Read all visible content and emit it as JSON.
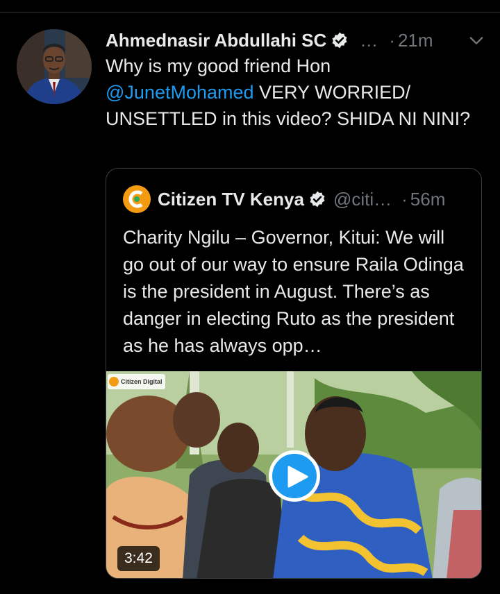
{
  "tweet": {
    "author_name": "Ahmednasir Abdullahi SC",
    "handle_truncated": "…",
    "separator": "·",
    "time": "21m",
    "text_before": "Why is my good friend Hon ",
    "mention": "@JunetMohamed",
    "text_after": " VERY WORRIED/ UNSETTLED in this video? SHIDA NI NINI?"
  },
  "quoted": {
    "author_name": "Citizen TV Kenya",
    "handle": "@citi…",
    "separator": "·",
    "time": "56m",
    "text": "Charity Ngilu – Governor, Kitui: We will go out of our way to ensure Raila Odinga is the president in August. There’s as danger in electing Ruto as the president as he has always opp…",
    "media": {
      "watermark": "Citizen Digital",
      "duration": "3:42"
    }
  },
  "icons": {
    "verified": "verified-badge-icon",
    "caret": "chevron-down-icon",
    "play": "play-icon"
  },
  "colors": {
    "background": "#000000",
    "text": "#e7e9ea",
    "muted": "#71767b",
    "link": "#1d9bf0",
    "accent": "#1d9bf0"
  }
}
